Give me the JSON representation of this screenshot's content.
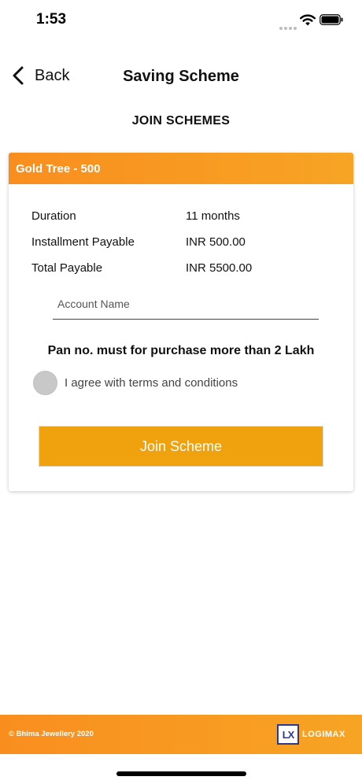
{
  "status_bar": {
    "time": "1:53"
  },
  "nav": {
    "back_label": "Back",
    "title": "Saving Scheme"
  },
  "section_title": "JOIN SCHEMES",
  "card": {
    "title": "Gold Tree - 500",
    "details": [
      {
        "label": "Duration",
        "value": "11 months"
      },
      {
        "label": "Installment Payable",
        "value": "INR 500.00"
      },
      {
        "label": "Total Payable",
        "value": "INR 5500.00"
      }
    ],
    "account_name": {
      "value": "",
      "placeholder": "Account Name"
    },
    "pan_note": "Pan no. must for purchase more than 2 Lakh",
    "agree_label": "I agree with terms and conditions",
    "agree_checked": false,
    "join_button_label": "Join Scheme"
  },
  "footer": {
    "copyright": "© Bhima Jewellery 2020",
    "logo_mark": "LX",
    "logo_text": "LOGIMAX"
  },
  "colors": {
    "accent_orange": "#f98e1f",
    "button_orange": "#efa10e",
    "logo_blue": "#2d3a8c"
  }
}
